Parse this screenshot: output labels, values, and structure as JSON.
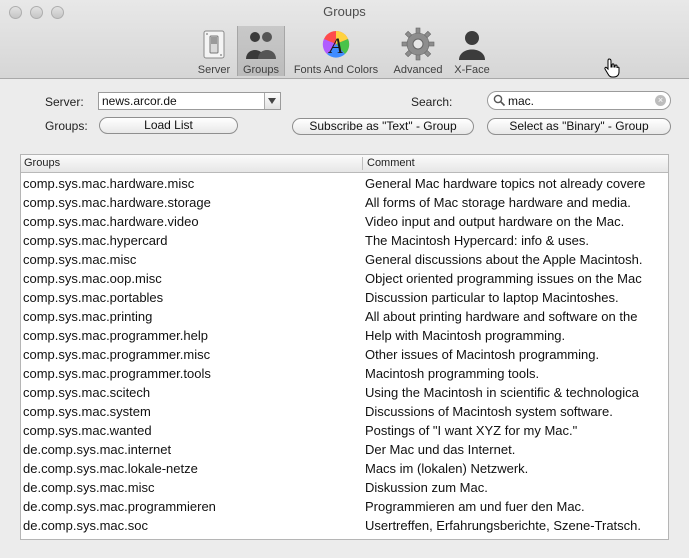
{
  "window": {
    "title": "Groups"
  },
  "toolbar": {
    "items": [
      {
        "label": "Server",
        "icon": "switch-icon"
      },
      {
        "label": "Groups",
        "icon": "people-icon"
      },
      {
        "label": "Fonts And Colors",
        "icon": "font-color-icon"
      },
      {
        "label": "Advanced",
        "icon": "gear-icon"
      },
      {
        "label": "X-Face",
        "icon": "face-silhouette-icon"
      }
    ]
  },
  "form": {
    "server_label": "Server:",
    "server_value": "news.arcor.de",
    "search_label": "Search:",
    "search_value": "mac.",
    "groups_label": "Groups:",
    "load_list_label": "Load List",
    "subscribe_label": "Subscribe as \"Text\" - Group",
    "select_binary_label": "Select as \"Binary\" - Group"
  },
  "table": {
    "columns": [
      "Groups",
      "Comment"
    ],
    "rows": [
      [
        "comp.sys.mac.hardware.misc",
        "General Mac hardware topics not already covere"
      ],
      [
        "comp.sys.mac.hardware.storage",
        "All forms of Mac storage hardware and media."
      ],
      [
        "comp.sys.mac.hardware.video",
        "Video input and output hardware on the Mac."
      ],
      [
        "comp.sys.mac.hypercard",
        "The Macintosh Hypercard: info & uses."
      ],
      [
        "comp.sys.mac.misc",
        "General discussions about the Apple Macintosh."
      ],
      [
        "comp.sys.mac.oop.misc",
        "Object oriented programming issues on the Mac"
      ],
      [
        "comp.sys.mac.portables",
        "Discussion particular to laptop Macintoshes."
      ],
      [
        "comp.sys.mac.printing",
        "All about printing hardware and software on the"
      ],
      [
        "comp.sys.mac.programmer.help",
        "Help with Macintosh programming."
      ],
      [
        "comp.sys.mac.programmer.misc",
        "Other issues of Macintosh programming."
      ],
      [
        "comp.sys.mac.programmer.tools",
        "Macintosh programming tools."
      ],
      [
        "comp.sys.mac.scitech",
        "Using the Macintosh in scientific & technologica"
      ],
      [
        "comp.sys.mac.system",
        "Discussions of Macintosh system software."
      ],
      [
        "comp.sys.mac.wanted",
        "Postings of \"I want XYZ for my Mac.\""
      ],
      [
        "de.comp.sys.mac.internet",
        "Der Mac und das Internet."
      ],
      [
        "de.comp.sys.mac.lokale-netze",
        "Macs im (lokalen) Netzwerk."
      ],
      [
        "de.comp.sys.mac.misc",
        "Diskussion zum Mac."
      ],
      [
        "de.comp.sys.mac.programmieren",
        "Programmieren am und fuer den Mac."
      ],
      [
        "de.comp.sys.mac.soc",
        "Usertreffen, Erfahrungsberichte, Szene-Tratsch."
      ]
    ]
  }
}
